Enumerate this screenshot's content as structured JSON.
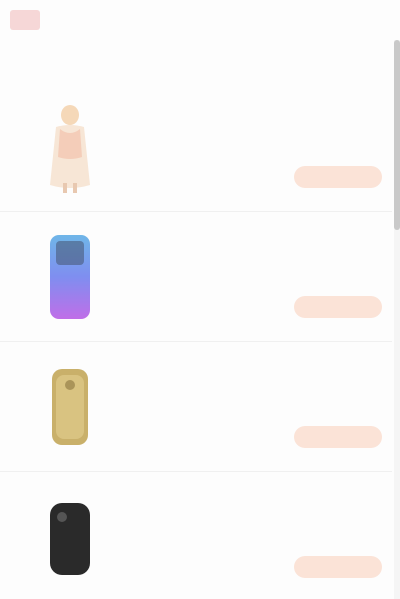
{
  "header": {
    "title": ""
  },
  "subheader": {
    "text": ""
  },
  "items": [
    {
      "title": "",
      "price": "",
      "action": ""
    },
    {
      "title": "",
      "price": "",
      "action": ""
    },
    {
      "title": "",
      "price": "",
      "action": ""
    },
    {
      "title": "",
      "price": "",
      "action": ""
    }
  ],
  "colors": {
    "accent": "#e7742f",
    "action_bg": "#fbe3d7",
    "logo": "#f3c9c9"
  },
  "icons": {
    "logo": "brand-logo-icon",
    "item_0_image": "product-image",
    "item_1_image": "product-image",
    "item_2_image": "product-image",
    "item_3_image": "product-image"
  }
}
